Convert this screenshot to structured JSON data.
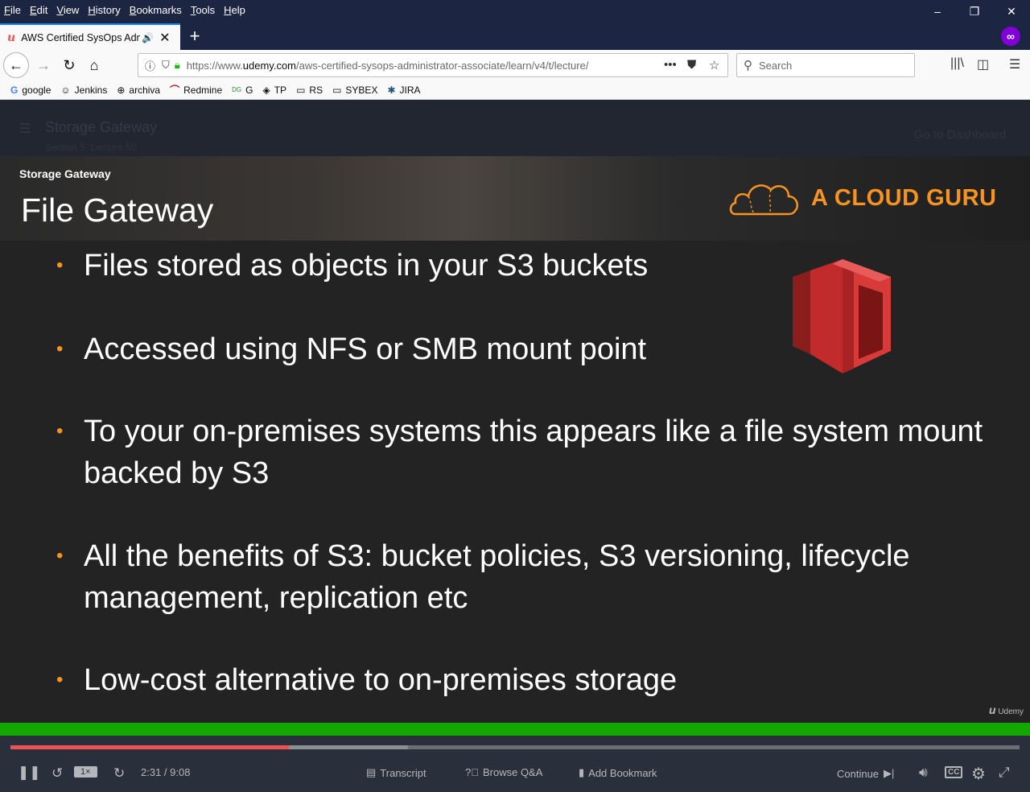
{
  "browser": {
    "menu": [
      "File",
      "Edit",
      "View",
      "History",
      "Bookmarks",
      "Tools",
      "Help"
    ],
    "window_controls": {
      "minimize": "–",
      "restore": "❐",
      "close": "✕"
    },
    "tab": {
      "title": "AWS Certified SysOps Admi",
      "favicon": "u",
      "sound_icon": "🔊",
      "close": "✕"
    },
    "new_tab": "+",
    "url": {
      "prefix": "https://www.",
      "domain": "udemy.com",
      "path": "/aws-certified-sysops-administrator-associate/learn/v4/t/lecture/"
    },
    "search_placeholder": "Search",
    "bookmarks": [
      {
        "label": "google",
        "icon": "G"
      },
      {
        "label": "Jenkins",
        "icon": "☺"
      },
      {
        "label": "archiva",
        "icon": "⊕"
      },
      {
        "label": "Redmine",
        "icon": "⌒"
      },
      {
        "label": "G",
        "icon": "DG"
      },
      {
        "label": "TP",
        "icon": "◈"
      },
      {
        "label": "RS",
        "icon": "▭"
      },
      {
        "label": "SYBEX",
        "icon": "▭"
      },
      {
        "label": "JIRA",
        "icon": "✱"
      }
    ]
  },
  "lecture": {
    "title": "Storage Gateway",
    "subtitle": "Section 5, Lecture 50",
    "dashboard_link": "Go to Dashboard"
  },
  "slide": {
    "section": "Storage Gateway",
    "title": "File Gateway",
    "logo_text": "A CLOUD GURU",
    "bullets": [
      "Files stored as objects in your S3 buckets",
      "Accessed using NFS or SMB mount point",
      "To your on-premises systems this appears like a file system mount backed by S3",
      "All the benefits of S3: bucket policies, S3 versioning, lifecycle management, replication etc",
      "Low-cost alternative to on-premises storage"
    ],
    "watermark": "Udemy"
  },
  "player": {
    "progress_fraction": 0.276,
    "buffered_fraction": 0.394,
    "rate": "1×",
    "time": "2:31 / 9:08",
    "transcript": "Transcript",
    "qa": "Browse Q&A",
    "bookmark": "Add Bookmark",
    "continue": "Continue"
  },
  "colors": {
    "accent": "#ec5252",
    "acg_orange": "#f7931e",
    "green_bar": "#13a800",
    "controls_bg": "#29303b"
  }
}
